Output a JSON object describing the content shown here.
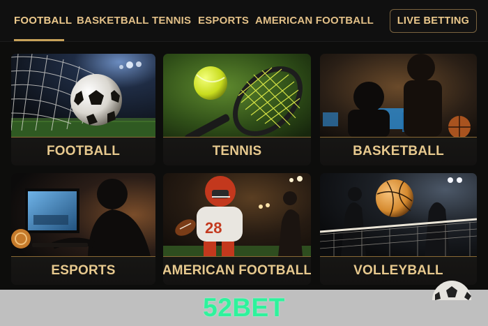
{
  "nav": {
    "tabs": [
      {
        "label": "FOOTBALL",
        "active": true
      },
      {
        "label": "BASKETBALL",
        "active": false
      },
      {
        "label": "TENNIS",
        "active": false
      },
      {
        "label": "ESPORTS",
        "active": false
      },
      {
        "label": "AMERICAN FOOTBALL",
        "active": false
      }
    ],
    "live_betting_label": "LIVE BETTING"
  },
  "cards": [
    {
      "label": "FOOTBALL",
      "image": "soccer-ball-in-net"
    },
    {
      "label": "TENNIS",
      "image": "tennis-racket-and-ball"
    },
    {
      "label": "BASKETBALL",
      "image": "fans-watching-screens"
    },
    {
      "label": "ESPORTS",
      "image": "gamer-at-monitor"
    },
    {
      "label": "AMERICAN FOOTBALL",
      "image": "american-football-player"
    },
    {
      "label": "VOLLEYBALL",
      "image": "volleyball-over-net"
    }
  ],
  "banner": {
    "brand": "52BET"
  },
  "colors": {
    "accent_gold": "#e7c98e",
    "background": "#0d0d0c",
    "banner_bg": "#bfbfbf",
    "brand_green": "#2ef39c"
  }
}
